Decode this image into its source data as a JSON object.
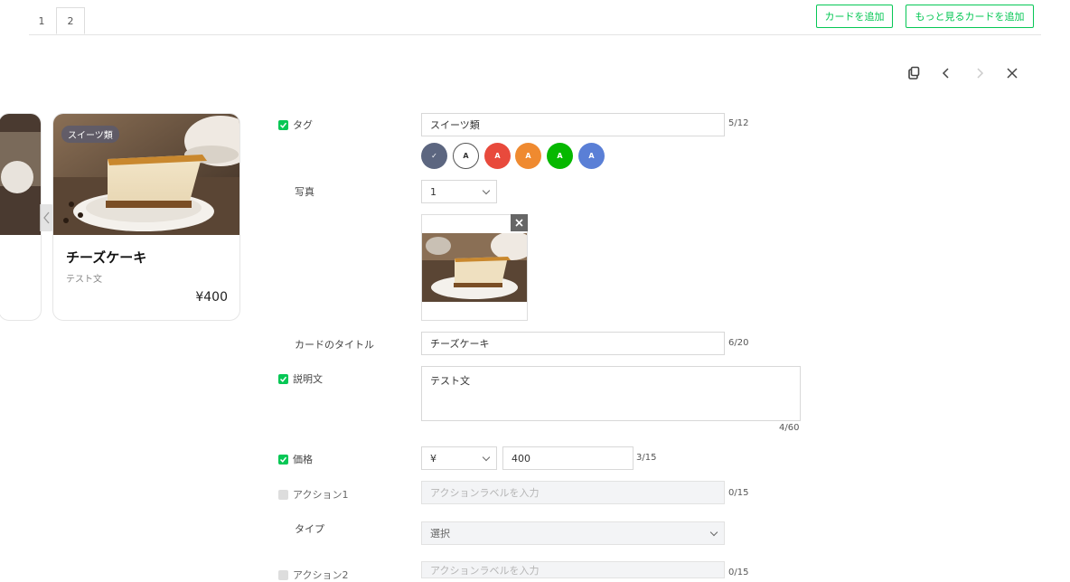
{
  "tabs": [
    "1",
    "2"
  ],
  "header": {
    "add_card": "カードを追加",
    "add_more_card": "もっと見るカードを追加"
  },
  "toolbar_icons": [
    "copy-icon",
    "chevron-left-icon",
    "chevron-right-icon",
    "close-icon"
  ],
  "preview_card": {
    "tag": "スイーツ類",
    "title": "チーズケーキ",
    "description": "テスト文",
    "price": "¥400"
  },
  "form": {
    "tag": {
      "label": "タグ",
      "value": "スイーツ類",
      "count": "5/12"
    },
    "tag_colors": [
      {
        "color": "#5c6680",
        "mark": "✓"
      },
      {
        "color": "#ffffff",
        "mark": "A"
      },
      {
        "color": "#e84a3c",
        "mark": "A"
      },
      {
        "color": "#ef8a30",
        "mark": "A"
      },
      {
        "color": "#06b800",
        "mark": "A"
      },
      {
        "color": "#5a7fd6",
        "mark": "A"
      }
    ],
    "photo": {
      "label": "写真",
      "select_value": "1"
    },
    "card_title": {
      "label": "カードのタイトル",
      "value": "チーズケーキ",
      "count": "6/20"
    },
    "description": {
      "label": "説明文",
      "value": "テスト文",
      "count": "4/60"
    },
    "price": {
      "label": "価格",
      "currency": "¥",
      "value": "400",
      "count": "3/15"
    },
    "action1": {
      "label": "アクション1",
      "placeholder": "アクションラベルを入力",
      "count": "0/15"
    },
    "type": {
      "label": "タイプ",
      "value": "選択"
    },
    "action2": {
      "label": "アクション2",
      "placeholder": "アクションラベルを入力",
      "count": "0/15"
    }
  },
  "colors": {
    "accent": "#06c755",
    "border": "#d8d8d8"
  }
}
